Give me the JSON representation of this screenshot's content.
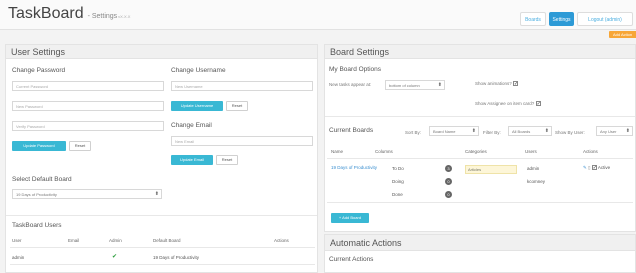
{
  "header": {
    "brand": "TaskBoard",
    "subtitle": "- Settings",
    "version": "vX.X.X",
    "nav": {
      "boards": "Boards",
      "settings": "Settings",
      "logout": "Logout (admin)"
    }
  },
  "user_settings": {
    "title": "User Settings",
    "change_password": {
      "label": "Change Password",
      "current_placeholder": "Current Password",
      "new_placeholder": "New Password",
      "verify_placeholder": "Verify Password",
      "update_btn": "Update Password",
      "reset_btn": "Reset"
    },
    "change_username": {
      "label": "Change Username",
      "placeholder": "New Username",
      "update_btn": "Update Username",
      "reset_btn": "Reset"
    },
    "change_email": {
      "label": "Change Email",
      "placeholder": "New Email",
      "update_btn": "Update Email",
      "reset_btn": "Reset"
    },
    "default_board": {
      "label": "Select Default Board",
      "value": "19 Days of Productivity"
    }
  },
  "users": {
    "title": "TaskBoard Users",
    "columns": [
      "User",
      "Email",
      "Admin",
      "Default Board",
      "Actions"
    ],
    "rows": [
      {
        "user": "admin",
        "email": "",
        "admin": "✔",
        "board": "19 Days of Productivity"
      }
    ]
  },
  "board_settings": {
    "title": "Board Settings",
    "options_label": "My Board Options",
    "new_tasks_label": "New tasks appear at:",
    "new_tasks_value": "bottom of column",
    "show_animations": "Show animations?",
    "show_assignee": "Show Assignee on item card?",
    "current_boards": "Current Boards",
    "sort_by": "Sort By:",
    "sort_value": "Board Name",
    "filter_by": "Filter By:",
    "filter_value": "All Boards",
    "show_by_user": "Show By User:",
    "user_value": "Any User",
    "columns": [
      "Name",
      "Columns",
      "Categories",
      "Users",
      "Actions"
    ],
    "board": {
      "name": "19 Days of Productivity",
      "cols": [
        "To Do",
        "Doing",
        "Done"
      ],
      "counts": [
        "3",
        "0",
        "0"
      ],
      "category": "Articles",
      "users": [
        "admin",
        "kcomney"
      ],
      "status": "Active"
    },
    "add_board": "+ Add Board"
  },
  "automatic_actions": {
    "title": "Automatic Actions",
    "current": "Current Actions"
  },
  "orange_label": "Add Action",
  "colors": {
    "primary": "#2d9ad6",
    "accent": "#39b8d4",
    "orange": "#f7a637",
    "check": "#2a9d3a"
  }
}
